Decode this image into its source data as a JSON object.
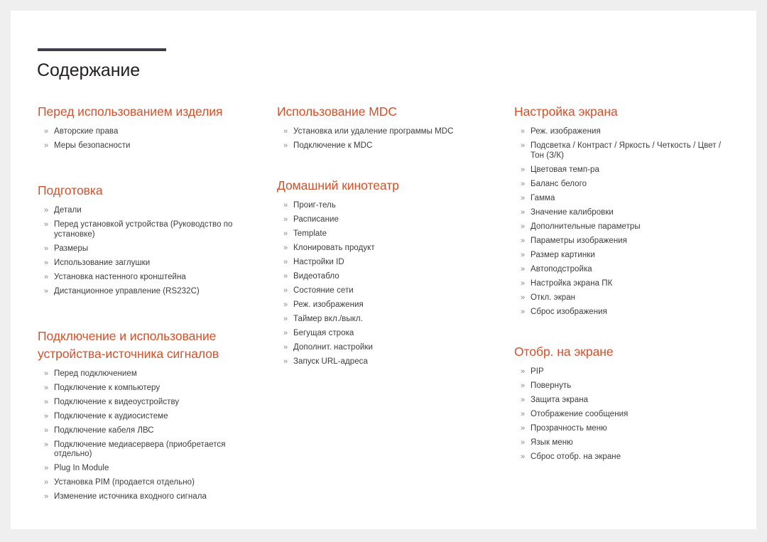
{
  "document": {
    "title": "Содержание",
    "accent_color": "#d4512a",
    "rule_color": "#3d3d47",
    "body_text_color": "#3c3c3c",
    "page_background": "#ffffff",
    "canvas_background": "#efefef",
    "bullet_glyph": "»"
  },
  "columns": [
    {
      "id": "column-left",
      "sections": [
        {
          "id": "section-before-using",
          "heading": "Перед использованием изделия",
          "items": [
            "Авторские права",
            "Меры безопасности"
          ]
        },
        {
          "id": "section-preparation",
          "heading": "Подготовка",
          "items": [
            "Детали",
            "Перед установкой устройства (Руководство по установке)",
            "Размеры",
            "Использование заглушки",
            "Установка настенного кронштейна",
            "Дистанционное управление (RS232C)"
          ]
        },
        {
          "id": "section-connecting-source",
          "heading": "Подключение и использование устройства-источника сигналов",
          "items": [
            "Перед подключением",
            "Подключение к компьютеру",
            "Подключение к видеоустройству",
            "Подключение к аудиосистеме",
            "Подключение кабеля ЛВС",
            "Подключение медиасервера (приобретается отдельно)",
            "Plug In Module",
            "Установка PIM (продается отдельно)",
            "Изменение источника входного сигнала"
          ]
        }
      ]
    },
    {
      "id": "column-middle",
      "sections": [
        {
          "id": "section-using-mdc",
          "heading": "Использование MDC",
          "items": [
            "Установка или удаление программы MDC",
            "Подключение к MDC"
          ]
        },
        {
          "id": "section-home-theatre",
          "heading": "Домашний кинотеатр",
          "items": [
            "Проиг-тель",
            "Расписание",
            "Template",
            "Клонировать продукт",
            "Настройки ID",
            "Видеотабло",
            "Состояние сети",
            "Реж. изображения",
            "Таймер вкл./выкл.",
            "Бегущая строка",
            "Дополнит. настройки",
            "Запуск URL-адреса"
          ]
        }
      ]
    },
    {
      "id": "column-right",
      "sections": [
        {
          "id": "section-screen-adjustment",
          "heading": "Настройка экрана",
          "items": [
            "Реж. изображения",
            "Подсветка / Контраст / Яркость / Четкость / Цвет / Тон (З/К)",
            "Цветовая темп-ра",
            "Баланс белого",
            "Гамма",
            "Значение калибровки",
            "Дополнительные параметры",
            "Параметры изображения",
            "Размер картинки",
            "Автоподстройка",
            "Настройка экрана ПК",
            "Откл. экран",
            "Сброс изображения"
          ]
        },
        {
          "id": "section-onscreen-display",
          "heading": "Отобр. на экране",
          "items": [
            "PIP",
            "Повернуть",
            "Защита экрана",
            "Отображение сообщения",
            "Прозрачность меню",
            "Язык меню",
            "Сброс отобр. на экране"
          ]
        }
      ]
    }
  ]
}
